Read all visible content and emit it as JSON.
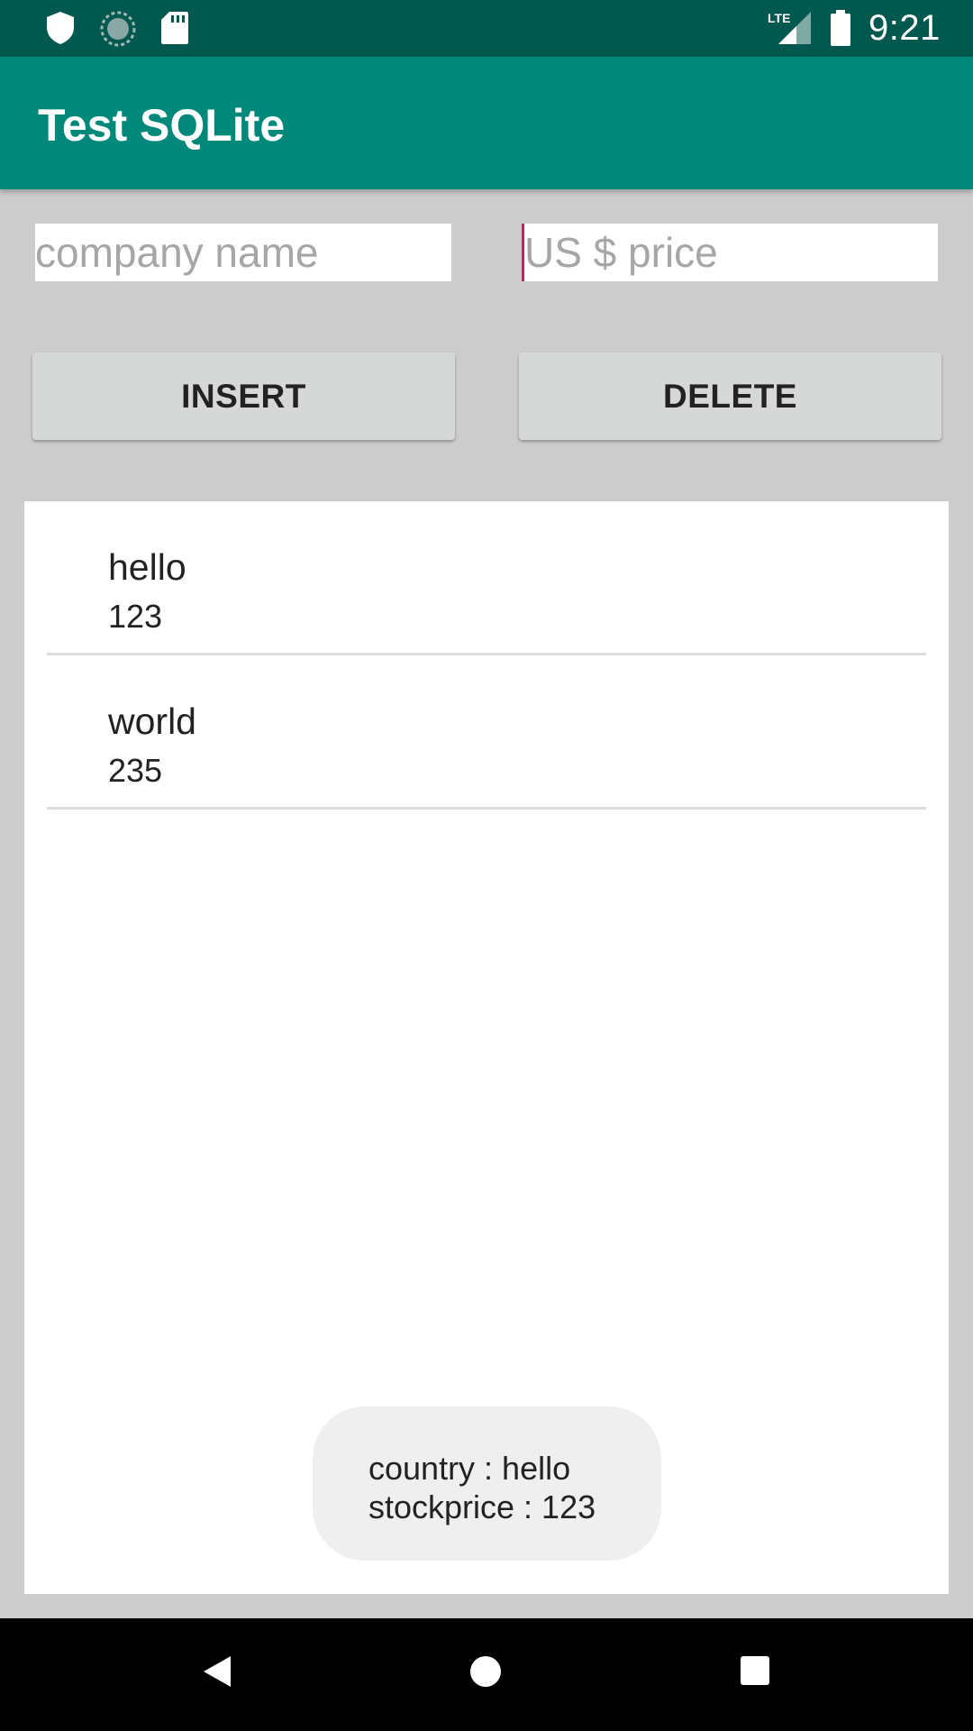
{
  "status_bar": {
    "time": "9:21",
    "network": "LTE",
    "icons": [
      "shield-icon",
      "sync-icon",
      "sd-card-icon",
      "lte-signal-icon",
      "battery-icon"
    ]
  },
  "app_bar": {
    "title": "Test SQLite",
    "color": "#00897b"
  },
  "form": {
    "company_placeholder": "company name",
    "price_placeholder": "US $ price",
    "insert_label": "INSERT",
    "delete_label": "DELETE"
  },
  "list": {
    "items": [
      {
        "name": "hello",
        "price": "123"
      },
      {
        "name": "world",
        "price": "235"
      }
    ]
  },
  "toast": {
    "line1": "country : hello",
    "line2": "stockprice : 123"
  },
  "nav_bar": {
    "icons": [
      "back-icon",
      "home-icon",
      "recents-icon"
    ]
  }
}
